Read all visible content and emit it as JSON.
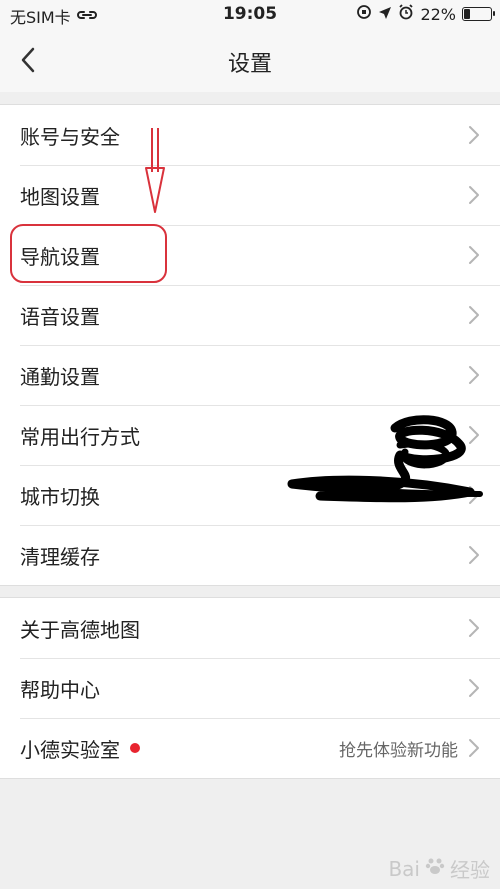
{
  "status_bar": {
    "carrier": "无SIM卡",
    "time": "19:05",
    "battery": "22%",
    "battery_level": 0.22
  },
  "nav": {
    "title": "设置"
  },
  "groups": [
    {
      "items": [
        {
          "label": "账号与安全"
        },
        {
          "label": "地图设置"
        },
        {
          "label": "导航设置"
        },
        {
          "label": "语音设置"
        },
        {
          "label": "通勤设置"
        },
        {
          "label": "常用出行方式"
        },
        {
          "label": "城市切换"
        },
        {
          "label": "清理缓存"
        }
      ]
    },
    {
      "items": [
        {
          "label": "关于高德地图"
        },
        {
          "label": "帮助中心"
        },
        {
          "label": "小德实验室",
          "value": "抢先体验新功能"
        }
      ]
    }
  ],
  "colors": {
    "background": "#efefef",
    "highlight": "#d9323c",
    "badge": "#e8242f"
  },
  "watermark": {
    "text": "Bai",
    "suffix": "经验"
  }
}
